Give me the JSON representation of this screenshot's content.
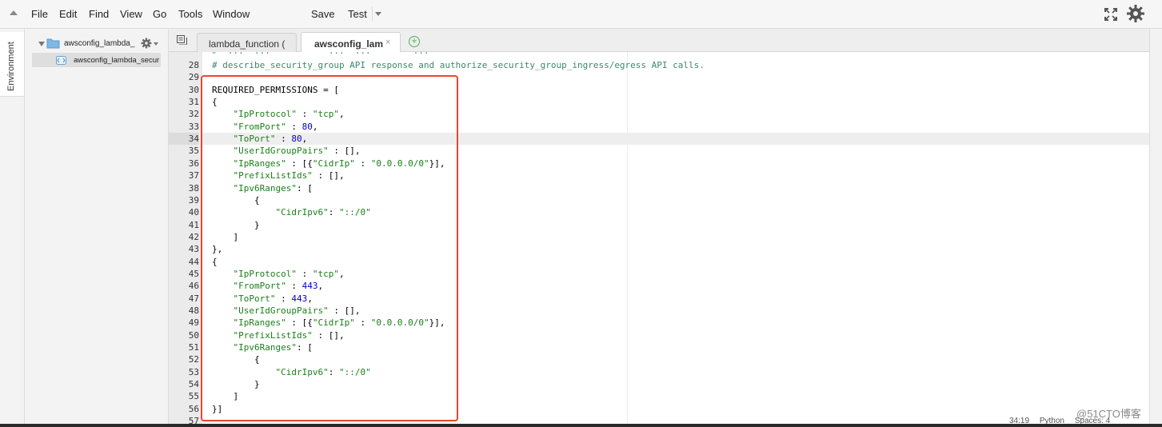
{
  "menubar": {
    "items": [
      "File",
      "Edit",
      "Find",
      "View",
      "Go",
      "Tools",
      "Window"
    ],
    "save": "Save",
    "test": "Test"
  },
  "rail": {
    "environment_tab": "Environment"
  },
  "tree": {
    "folder": "awsconfig_lambda_",
    "file": "awsconfig_lambda_secur"
  },
  "tabs": [
    {
      "label": "lambda_function (",
      "active": false
    },
    {
      "label": "awsconfig_lambе",
      "active": true,
      "close": "×"
    }
  ],
  "tab_add": "+",
  "editor": {
    "clipped_line": "#  ...  ...           ...  ...        ...",
    "lines": [
      {
        "n": "28",
        "tokens": [
          [
            "c",
            "# describe_security_group API response and authorize_security_group_ingress/egress API calls."
          ]
        ]
      },
      {
        "n": "29",
        "tokens": []
      },
      {
        "n": "30",
        "tokens": [
          [
            "p",
            "REQUIRED_PERMISSIONS = ["
          ]
        ]
      },
      {
        "n": "31",
        "tokens": [
          [
            "p",
            "{"
          ]
        ]
      },
      {
        "n": "32",
        "tokens": [
          [
            "p",
            "    "
          ],
          [
            "s",
            "\"IpProtocol\""
          ],
          [
            "p",
            " : "
          ],
          [
            "s",
            "\"tcp\""
          ],
          [
            "p",
            ","
          ]
        ]
      },
      {
        "n": "33",
        "tokens": [
          [
            "p",
            "    "
          ],
          [
            "s",
            "\"FromPort\""
          ],
          [
            "p",
            " : "
          ],
          [
            "n",
            "80"
          ],
          [
            "p",
            ","
          ]
        ]
      },
      {
        "n": "34",
        "tokens": [
          [
            "p",
            "    "
          ],
          [
            "s",
            "\"ToPort\""
          ],
          [
            "p",
            " : "
          ],
          [
            "n",
            "80"
          ],
          [
            "p",
            ","
          ]
        ],
        "active": true
      },
      {
        "n": "35",
        "tokens": [
          [
            "p",
            "    "
          ],
          [
            "s",
            "\"UserIdGroupPairs\""
          ],
          [
            "p",
            " : [],"
          ]
        ]
      },
      {
        "n": "36",
        "tokens": [
          [
            "p",
            "    "
          ],
          [
            "s",
            "\"IpRanges\""
          ],
          [
            "p",
            " : [{"
          ],
          [
            "s",
            "\"CidrIp\""
          ],
          [
            "p",
            " : "
          ],
          [
            "s",
            "\"0.0.0.0/0\""
          ],
          [
            "p",
            "}],"
          ]
        ]
      },
      {
        "n": "37",
        "tokens": [
          [
            "p",
            "    "
          ],
          [
            "s",
            "\"PrefixListIds\""
          ],
          [
            "p",
            " : [],"
          ]
        ]
      },
      {
        "n": "38",
        "tokens": [
          [
            "p",
            "    "
          ],
          [
            "s",
            "\"Ipv6Ranges\""
          ],
          [
            "p",
            ": ["
          ]
        ]
      },
      {
        "n": "39",
        "tokens": [
          [
            "p",
            "        {"
          ]
        ]
      },
      {
        "n": "40",
        "tokens": [
          [
            "p",
            "            "
          ],
          [
            "s",
            "\"CidrIpv6\""
          ],
          [
            "p",
            ": "
          ],
          [
            "s",
            "\"::/0\""
          ]
        ]
      },
      {
        "n": "41",
        "tokens": [
          [
            "p",
            "        }"
          ]
        ]
      },
      {
        "n": "42",
        "tokens": [
          [
            "p",
            "    ]"
          ]
        ]
      },
      {
        "n": "43",
        "tokens": [
          [
            "p",
            "},"
          ]
        ]
      },
      {
        "n": "44",
        "tokens": [
          [
            "p",
            "{"
          ]
        ]
      },
      {
        "n": "45",
        "tokens": [
          [
            "p",
            "    "
          ],
          [
            "s",
            "\"IpProtocol\""
          ],
          [
            "p",
            " : "
          ],
          [
            "s",
            "\"tcp\""
          ],
          [
            "p",
            ","
          ]
        ]
      },
      {
        "n": "46",
        "tokens": [
          [
            "p",
            "    "
          ],
          [
            "s",
            "\"FromPort\""
          ],
          [
            "p",
            " : "
          ],
          [
            "n",
            "443"
          ],
          [
            "p",
            ","
          ]
        ]
      },
      {
        "n": "47",
        "tokens": [
          [
            "p",
            "    "
          ],
          [
            "s",
            "\"ToPort\""
          ],
          [
            "p",
            " : "
          ],
          [
            "n",
            "443"
          ],
          [
            "p",
            ","
          ]
        ]
      },
      {
        "n": "48",
        "tokens": [
          [
            "p",
            "    "
          ],
          [
            "s",
            "\"UserIdGroupPairs\""
          ],
          [
            "p",
            " : [],"
          ]
        ]
      },
      {
        "n": "49",
        "tokens": [
          [
            "p",
            "    "
          ],
          [
            "s",
            "\"IpRanges\""
          ],
          [
            "p",
            " : [{"
          ],
          [
            "s",
            "\"CidrIp\""
          ],
          [
            "p",
            " : "
          ],
          [
            "s",
            "\"0.0.0.0/0\""
          ],
          [
            "p",
            "}],"
          ]
        ]
      },
      {
        "n": "50",
        "tokens": [
          [
            "p",
            "    "
          ],
          [
            "s",
            "\"PrefixListIds\""
          ],
          [
            "p",
            " : [],"
          ]
        ]
      },
      {
        "n": "51",
        "tokens": [
          [
            "p",
            "    "
          ],
          [
            "s",
            "\"Ipv6Ranges\""
          ],
          [
            "p",
            ": ["
          ]
        ]
      },
      {
        "n": "52",
        "tokens": [
          [
            "p",
            "        {"
          ]
        ]
      },
      {
        "n": "53",
        "tokens": [
          [
            "p",
            "            "
          ],
          [
            "s",
            "\"CidrIpv6\""
          ],
          [
            "p",
            ": "
          ],
          [
            "s",
            "\"::/0\""
          ]
        ]
      },
      {
        "n": "54",
        "tokens": [
          [
            "p",
            "        }"
          ]
        ]
      },
      {
        "n": "55",
        "tokens": [
          [
            "p",
            "    ]"
          ]
        ]
      },
      {
        "n": "56",
        "tokens": [
          [
            "p",
            "}]"
          ]
        ]
      },
      {
        "n": "57",
        "tokens": []
      }
    ]
  },
  "status": {
    "position": "34:19",
    "language": "Python",
    "spaces": "Spaces: 4"
  },
  "watermark": "@51CTO博客",
  "colors": {
    "highlight_box": "#e8472f",
    "string": "#1a7f1a",
    "number": "#0000cd",
    "comment": "#3a8a6a"
  },
  "icons": [
    "collapse-caret-icon",
    "fullscreen-icon",
    "settings-gear-icon",
    "folder-icon",
    "file-icon",
    "tree-gear-icon",
    "tab-list-icon",
    "add-tab-icon"
  ]
}
